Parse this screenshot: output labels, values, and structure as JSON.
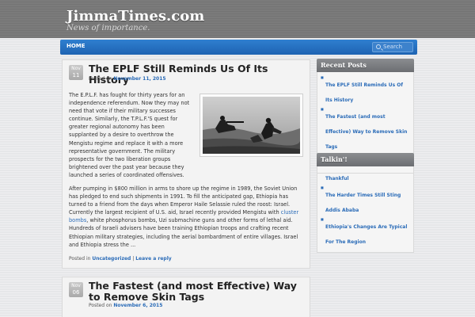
{
  "site": {
    "title": "JimmaTimes.com",
    "tagline": "News of importance."
  },
  "nav": {
    "home_label": "HOME",
    "search_placeholder": "Search"
  },
  "posts": [
    {
      "date_month": "Nov",
      "date_day": "11",
      "title": "The EPLF Still Reminds Us Of Its History",
      "meta_prefix": "Posted on",
      "meta_date": "November 11, 2015",
      "excerpt_paragraph_1": "The E.P.L.F. has fought for thirty years for an independence referendum. Now they may not need that vote if their military successes continue. Similarly, the T.P.L.F.'S quest for greater regional autonomy has been supplanted by a desire to overthrow the Mengistu regime and replace it with a more representative government. The military prospects for the two liberation groups brightened over the past year because they launched a series of coordinated offensives.",
      "excerpt_paragraph_2_before_link": "After pumping in $800 million in arms to shore up the regime in 1989, the Soviet Union has pledged to end such shipments in 1991. To fill the anticipated gap, Ethiopia has turned to a friend from the days when Emperor Haile Selassie ruled the roost: Israel. Currently the largest recipient of U.S. aid, Israel recently provided Mengistu with ",
      "excerpt_paragraph_2_link": "cluster bombs",
      "excerpt_paragraph_2_after_link": ", white phosphorus bombs, Uzi submachine guns and other forms of lethal aid. Hundreds of Israeli advisers have been training Ethiopian troops and crafting recent Ethiopian military strategies, including the aerial bombardment of entire villages. Israel and Ethiopia stress the ...",
      "footer_prefix": "Posted in",
      "footer_category": "Uncategorized",
      "footer_separator": "|",
      "footer_reply": "Leave a reply"
    },
    {
      "date_month": "Nov",
      "date_day": "06",
      "title": "The Fastest (and most Effective) Way to Remove Skin Tags",
      "meta_prefix": "Posted on",
      "meta_date": "November 6, 2015"
    }
  ],
  "sidebar": {
    "recent_title": "Recent Posts",
    "recent_items": [
      "The EPLF Still Reminds Us Of Its History",
      "The Fastest (and most Effective) Way to Remove Skin Tags",
      "Ex-Ethiopian Jews Still Thankful",
      "The Harder Times Still Sting Addis Ababa",
      "Ethiopia's Changes Are Typical For The Region"
    ],
    "talkin_title": "Talkin'!"
  },
  "colors": {
    "accent": "#2b6cb8",
    "nav_bar": "#2372c2",
    "header_bg": "#7b7b7b"
  }
}
